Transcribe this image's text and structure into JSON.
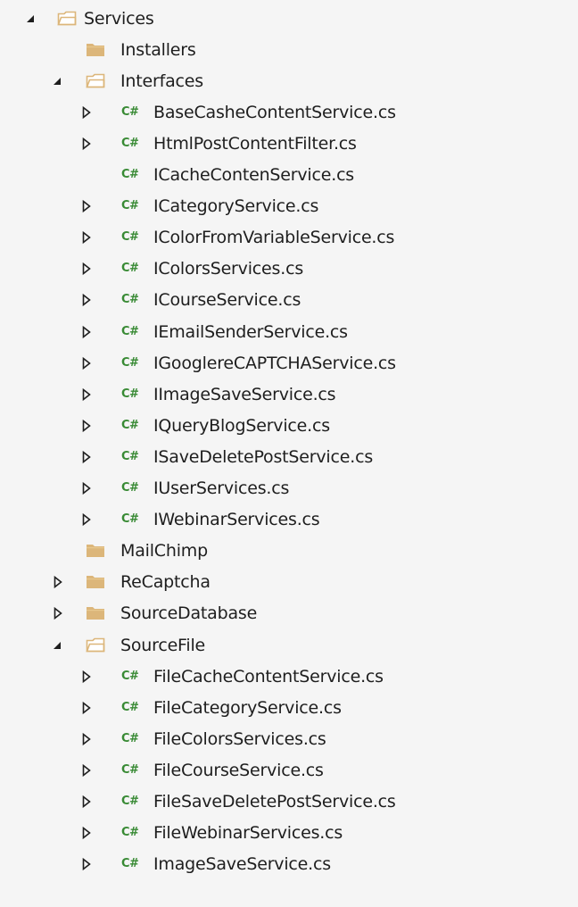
{
  "tree": {
    "services": {
      "label": "Services",
      "state": "expanded"
    },
    "installers": {
      "label": "Installers",
      "state": "leaf"
    },
    "interfaces": {
      "label": "Interfaces",
      "state": "expanded"
    },
    "interface_files": [
      {
        "label": "BaseCasheContentService.cs",
        "state": "collapsed"
      },
      {
        "label": "HtmlPostContentFilter.cs",
        "state": "collapsed"
      },
      {
        "label": "ICacheContenService.cs",
        "state": "leaf"
      },
      {
        "label": "ICategoryService.cs",
        "state": "collapsed"
      },
      {
        "label": "IColorFromVariableService.cs",
        "state": "collapsed"
      },
      {
        "label": "IColorsServices.cs",
        "state": "collapsed"
      },
      {
        "label": "ICourseService.cs",
        "state": "collapsed"
      },
      {
        "label": "IEmailSenderService.cs",
        "state": "collapsed"
      },
      {
        "label": "IGooglereCAPTCHAService.cs",
        "state": "collapsed"
      },
      {
        "label": "IImageSaveService.cs",
        "state": "collapsed"
      },
      {
        "label": "IQueryBlogService.cs",
        "state": "collapsed"
      },
      {
        "label": "ISaveDeletePostService.cs",
        "state": "collapsed"
      },
      {
        "label": "IUserServices.cs",
        "state": "collapsed"
      },
      {
        "label": "IWebinarServices.cs",
        "state": "collapsed"
      }
    ],
    "mailchimp": {
      "label": "MailChimp",
      "state": "leaf"
    },
    "recaptcha": {
      "label": "ReCaptcha",
      "state": "collapsed"
    },
    "sourcedatabase": {
      "label": "SourceDatabase",
      "state": "collapsed"
    },
    "sourcefile": {
      "label": "SourceFile",
      "state": "expanded"
    },
    "sourcefile_files": [
      {
        "label": "FileCacheContentService.cs",
        "state": "collapsed"
      },
      {
        "label": "FileCategoryService.cs",
        "state": "collapsed"
      },
      {
        "label": "FileColorsServices.cs",
        "state": "collapsed"
      },
      {
        "label": "FileCourseService.cs",
        "state": "collapsed"
      },
      {
        "label": "FileSaveDeletePostService.cs",
        "state": "collapsed"
      },
      {
        "label": "FileWebinarServices.cs",
        "state": "collapsed"
      },
      {
        "label": "ImageSaveService.cs",
        "state": "collapsed"
      }
    ]
  },
  "icons": {
    "folder": "folder-icon",
    "open_folder": "folder-open-icon",
    "csharp": "csharp-file-icon",
    "csharp_text": "C#",
    "expand": "chevron-right-icon",
    "collapse": "chevron-down-icon"
  },
  "colors": {
    "background": "#f5f5f5",
    "folder_fill": "#dcb67a",
    "csharp": "#388a34",
    "text": "#1e1e1e",
    "toggle": "#1e1e1e"
  }
}
